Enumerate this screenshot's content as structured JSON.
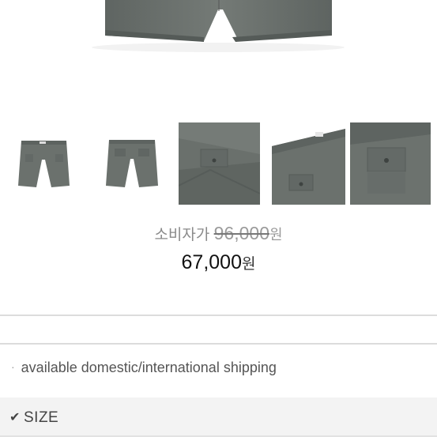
{
  "product": {
    "hero_alt": "grey chino shorts main image",
    "thumbnails": [
      {
        "icon": "shorts-front-thumbnail"
      },
      {
        "icon": "shorts-back-thumbnail"
      },
      {
        "icon": "shorts-pocket-detail-thumbnail"
      },
      {
        "icon": "shorts-waist-detail-thumbnail"
      },
      {
        "icon": "shorts-back-pocket-thumbnail"
      }
    ]
  },
  "price": {
    "consumer_label": "소비자가",
    "original_price": "96,000",
    "original_currency": "원",
    "sale_price": "67,000",
    "sale_currency": "원"
  },
  "info": {
    "bullet": "·",
    "shipping_text": "available domestic/international shipping"
  },
  "options": {
    "check_glyph": "✔",
    "size_label": "SIZE"
  },
  "colors": {
    "product_grey": "#6b716d",
    "price_text": "#111111",
    "muted_text": "#8a8a8a"
  }
}
